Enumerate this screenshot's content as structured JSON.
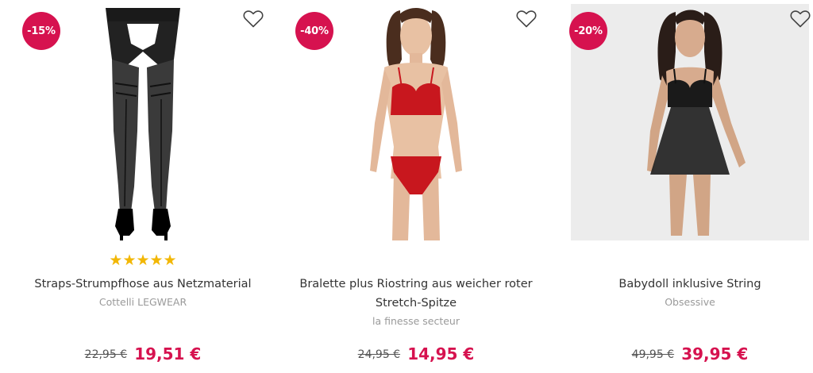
{
  "products": [
    {
      "discount": "-15%",
      "rating_stars": "★★★★★",
      "title": "Straps-Strumpfhose aus Netzmaterial",
      "brand": "Cottelli LEGWEAR",
      "old_price": "22,95 €",
      "new_price": "19,51 €",
      "wishlist_icon": "heart-outline-icon"
    },
    {
      "discount": "-40%",
      "title": "Bralette plus Riostring aus weicher roter Stretch-Spitze",
      "brand": "la finesse secteur",
      "old_price": "24,95 €",
      "new_price": "14,95 €",
      "wishlist_icon": "heart-outline-icon"
    },
    {
      "discount": "-20%",
      "title": "Babydoll inklusive String",
      "brand": "Obsessive",
      "old_price": "49,95 €",
      "new_price": "39,95 €",
      "wishlist_icon": "heart-outline-icon"
    }
  ],
  "colors": {
    "badge": "#d6124f",
    "sale_price": "#d6124f",
    "stars": "#f2b705",
    "brand_text": "#9a9a9a"
  }
}
